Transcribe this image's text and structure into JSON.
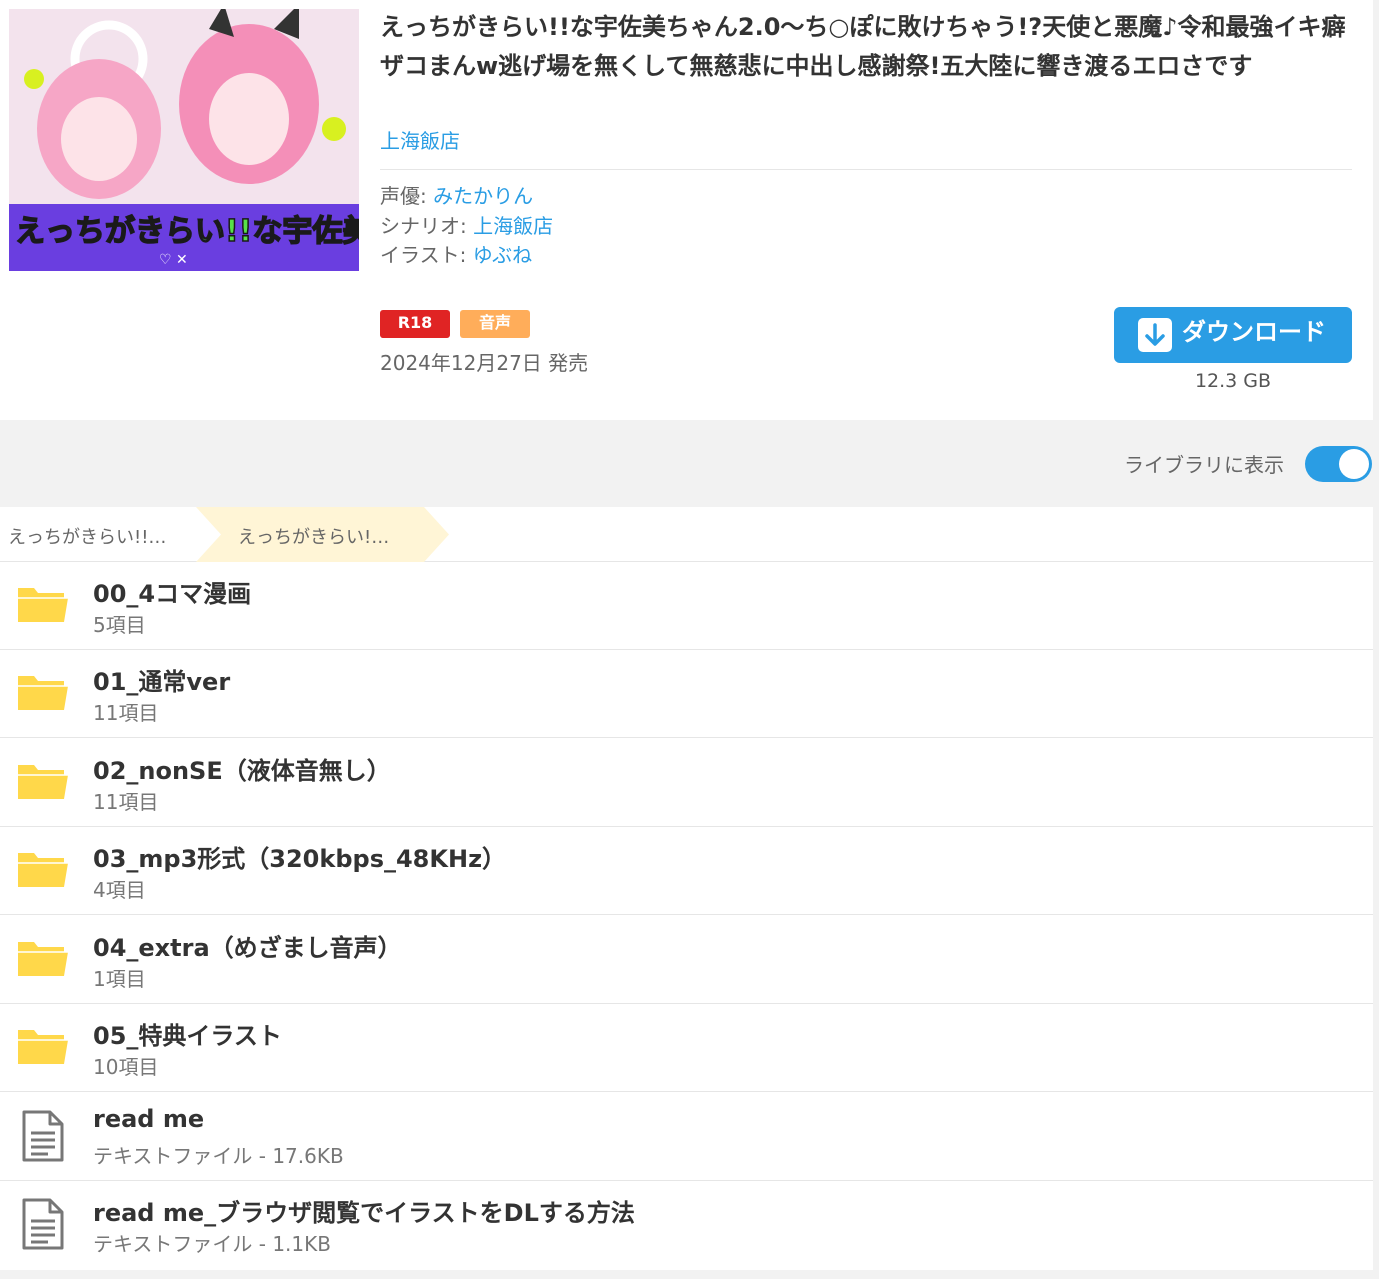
{
  "product": {
    "title": "えっちがきらい!!な宇佐美ちゃん2.0〜ち○ぽに敗けちゃう!?天使と悪魔♪令和最強イキ癖ザコまんw逃げ場を無くして無慈悲に中出し感謝祭!五大陸に響き渡るエロさです",
    "circle": "上海飯店",
    "credits": [
      {
        "label": "声優: ",
        "value": "みたかりん"
      },
      {
        "label": "シナリオ: ",
        "value": "上海飯店"
      },
      {
        "label": "イラスト: ",
        "value": "ゆぶね"
      }
    ],
    "badges": {
      "r18": "R18",
      "voice": "音声"
    },
    "release_date": "2024年12月27日 発売"
  },
  "download": {
    "label": "ダウンロード",
    "size": "12.3 GB"
  },
  "library_toggle": {
    "label": "ライブラリに表示",
    "on": true
  },
  "breadcrumb": {
    "item1": "えっちがきらい!!…",
    "item2": "えっちがきらい!…"
  },
  "items": [
    {
      "type": "folder",
      "name": "00_4コマ漫画",
      "sub": "5項目"
    },
    {
      "type": "folder",
      "name": "01_通常ver",
      "sub": "11項目"
    },
    {
      "type": "folder",
      "name": "02_nonSE（液体音無し）",
      "sub": "11項目"
    },
    {
      "type": "folder",
      "name": "03_mp3形式（320kbps_48KHz）",
      "sub": "4項目"
    },
    {
      "type": "folder",
      "name": "04_extra（めざまし音声）",
      "sub": "1項目"
    },
    {
      "type": "folder",
      "name": "05_特典イラスト",
      "sub": "10項目"
    },
    {
      "type": "file",
      "name": "read me",
      "sub": "テキストファイル - 17.6KB"
    },
    {
      "type": "file",
      "name": "read me_ブラウザ閲覧でイラストをDLする方法",
      "sub": "テキストファイル - 1.1KB"
    }
  ],
  "colors": {
    "accent": "#2a9de4",
    "r18": "#e02424",
    "voice": "#ffad5a",
    "folder": "#ffd84a",
    "crumb_active": "#fff5d6"
  }
}
